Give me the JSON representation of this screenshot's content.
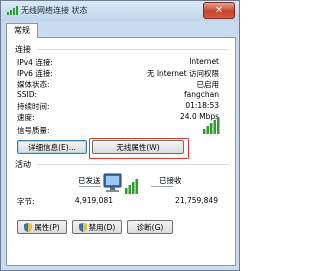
{
  "window": {
    "title": "无线网络连接 状态",
    "close_label": "✕"
  },
  "tab": {
    "label": "常规"
  },
  "connection": {
    "heading": "连接",
    "rows": [
      {
        "label": "IPv4 连接:",
        "value": "Internet"
      },
      {
        "label": "IPv6 连接:",
        "value": "无 Internet 访问权限"
      },
      {
        "label": "媒体状态:",
        "value": "已启用"
      },
      {
        "label": "SSID:",
        "value": "fangchan"
      },
      {
        "label": "持续时间:",
        "value": "01:18:53"
      },
      {
        "label": "速度:",
        "value": "24.0 Mbps"
      }
    ],
    "signal_label": "信号质量:",
    "signal_bars": 5,
    "details_button": "详细信息(E)...",
    "wireless_props_button": "无线属性(W)"
  },
  "activity": {
    "heading": "活动",
    "sent_label": "已发送",
    "received_label": "已接收",
    "bytes_label": "字节:",
    "sent_bytes": "4,919,081",
    "received_bytes": "21,759,849"
  },
  "buttons": {
    "properties": "属性(P)",
    "disable": "禁用(D)",
    "diagnose": "诊断(G)"
  },
  "colors": {
    "signal_green": "#2f9e2f",
    "highlight_red": "#e0352b"
  }
}
